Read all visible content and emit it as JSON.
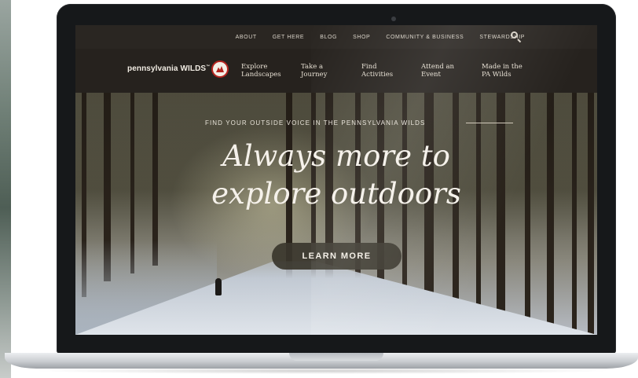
{
  "site": {
    "logo_text": "pennsylvania WILDS",
    "logo_tm": "™"
  },
  "top_nav": [
    {
      "label": "ABOUT"
    },
    {
      "label": "GET HERE"
    },
    {
      "label": "BLOG"
    },
    {
      "label": "SHOP"
    },
    {
      "label": "COMMUNITY & BUSINESS"
    },
    {
      "label": "STEWARDSHIP"
    }
  ],
  "main_nav": [
    {
      "line1": "Explore",
      "line2": "Landscapes"
    },
    {
      "line1": "Take a",
      "line2": "Journey"
    },
    {
      "line1": "Find",
      "line2": "Activities"
    },
    {
      "line1": "Attend an",
      "line2": "Event"
    },
    {
      "line1": "Made in the",
      "line2": "PA Wilds"
    }
  ],
  "hero": {
    "tagline": "FIND YOUR OUTSIDE VOICE IN THE PENNSYLVANIA WILDS",
    "headline_line1": "Always more to",
    "headline_line2": "explore outdoors",
    "cta_label": "LEARN MORE"
  },
  "colors": {
    "brand_red": "#b3241f",
    "nav_bg": "#26221e",
    "cta_bg": "#3a362c"
  },
  "icons": {
    "search": "search-icon",
    "logo_emblem": "pa-wilds-emblem-icon"
  }
}
